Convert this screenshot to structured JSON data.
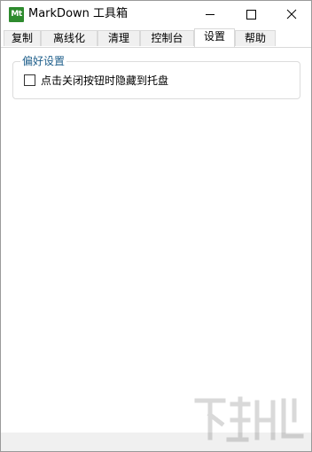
{
  "window": {
    "icon_text": "Mt",
    "title": "MarkDown 工具箱",
    "controls": {
      "minimize": "minimize-icon",
      "maximize": "maximize-icon",
      "close": "close-icon"
    }
  },
  "tabs": [
    {
      "label": "复制",
      "active": false
    },
    {
      "label": "离线化",
      "active": false
    },
    {
      "label": "清理",
      "active": false
    },
    {
      "label": "控制台",
      "active": false
    },
    {
      "label": "设置",
      "active": true
    },
    {
      "label": "帮助",
      "active": false
    }
  ],
  "settings": {
    "group_title": "偏好设置",
    "hide_to_tray": {
      "label": "点击关闭按钮时隐藏到托盘",
      "checked": false
    }
  },
  "colors": {
    "app_icon_bg": "#2e8b2e",
    "group_title": "#1f5f8b",
    "tab_border": "#d9d9d9",
    "tab_inactive_bg": "#f0f0f0"
  }
}
